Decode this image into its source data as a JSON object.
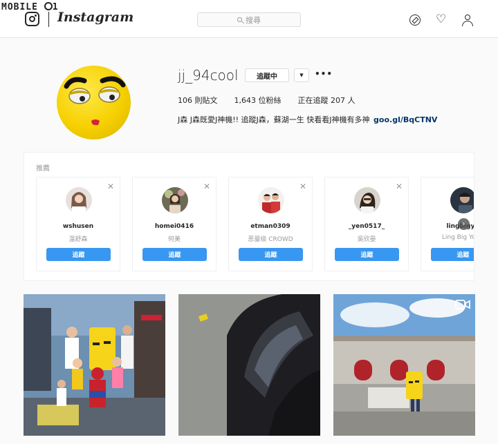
{
  "watermark": {
    "text_left": "MOBILE",
    "text_right": "1"
  },
  "nav": {
    "wordmark": "Instagram",
    "search_placeholder": "搜尋",
    "icons": [
      "instagram-glyph-icon",
      "compass-icon",
      "heart-icon",
      "person-icon"
    ]
  },
  "profile": {
    "username": "jj_94cool",
    "follow_status_label": "追蹤中",
    "dropdown_glyph": "▼",
    "more_glyph": "•••",
    "stats": {
      "posts": "106 則貼文",
      "followers": "1,643 位粉絲",
      "following": "正在追蹤 207 人"
    },
    "bio_text": "J森 J森既愛J神機!! 追蹤J森，蘇湖一生 快看看J神機有多神",
    "bio_link": "goo.gl/BqCTNV"
  },
  "suggestions": {
    "title": "推薦",
    "follow_label": "追蹤",
    "close_glyph": "✕",
    "next_glyph": "›",
    "cards": [
      {
        "username": "wshusen",
        "real_name": "温舒森"
      },
      {
        "username": "homei0416",
        "real_name": "何美"
      },
      {
        "username": "etman0309",
        "real_name": "恶量级 CROWD"
      },
      {
        "username": "_yen0517_",
        "real_name": "吳欣晏"
      },
      {
        "username": "lingbigyo",
        "real_name": "Ling Big Yong"
      }
    ]
  },
  "posts": [
    {
      "type": "photo",
      "subject": "mascot-with-group"
    },
    {
      "type": "photo",
      "subject": "scooter-headlight"
    },
    {
      "type": "video",
      "subject": "mascot-at-stadium"
    }
  ],
  "colors": {
    "accent_blue": "#3897f0",
    "link_blue": "#003569",
    "mascot_yellow": "#f6d000",
    "page_bg": "#fafafa"
  }
}
